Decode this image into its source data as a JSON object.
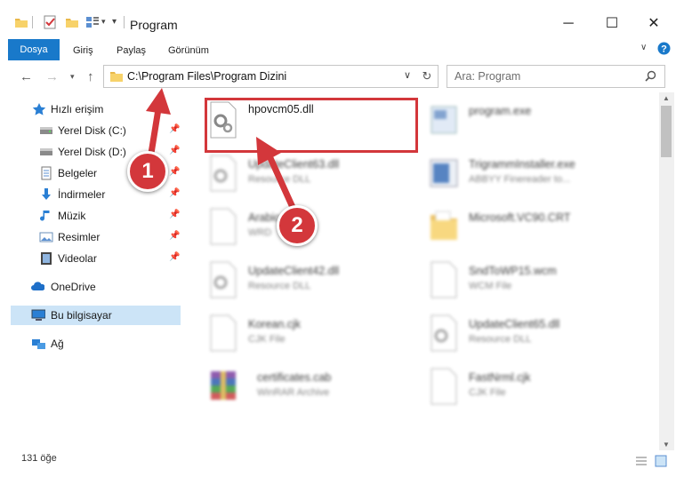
{
  "window": {
    "title": "Program"
  },
  "ribbon": {
    "tabs": [
      "Dosya",
      "Giriş",
      "Paylaş",
      "Görünüm"
    ]
  },
  "address": {
    "path": "C:\\Program Files\\Program Dizini"
  },
  "search": {
    "placeholder": "Ara: Program"
  },
  "sidebar": {
    "quick_access": "Hızlı erişim",
    "items": [
      {
        "label": "Yerel Disk (C:)",
        "icon": "drive-icon"
      },
      {
        "label": "Yerel Disk (D:)",
        "icon": "drive-icon"
      },
      {
        "label": "Belgeler",
        "icon": "documents-icon"
      },
      {
        "label": "İndirmeler",
        "icon": "download-icon"
      },
      {
        "label": "Müzik",
        "icon": "music-icon"
      },
      {
        "label": "Resimler",
        "icon": "pictures-icon"
      },
      {
        "label": "Videolar",
        "icon": "video-icon"
      }
    ],
    "onedrive": "OneDrive",
    "this_pc": "Bu bilgisayar",
    "network": "Ağ"
  },
  "files": [
    {
      "name": "hpovcm05.dll",
      "type": ""
    },
    {
      "name": "program.exe",
      "type": ""
    },
    {
      "name": "UpdateClient63.dll",
      "type": "Resource DLL"
    },
    {
      "name": "TrigrammInstaller.exe",
      "type": "ABBYY Finereader to..."
    },
    {
      "name": "Arabic",
      "type": "WRD"
    },
    {
      "name": "Microsoft.VC90.CRT",
      "type": ""
    },
    {
      "name": "UpdateClient42.dll",
      "type": "Resource DLL"
    },
    {
      "name": "SndToWP15.wcm",
      "type": "WCM File"
    },
    {
      "name": "Korean.cjk",
      "type": "CJK File"
    },
    {
      "name": "UpdateClient65.dll",
      "type": "Resource DLL"
    },
    {
      "name": "certificates.cab",
      "type": "WinRAR Archive"
    },
    {
      "name": "FastNrml.cjk",
      "type": "CJK File"
    }
  ],
  "status": {
    "count": "131 öğe"
  },
  "callouts": [
    "1",
    "2"
  ],
  "colors": {
    "accent": "#1979ca",
    "callout": "#d3373b",
    "selection": "#cce4f7"
  }
}
